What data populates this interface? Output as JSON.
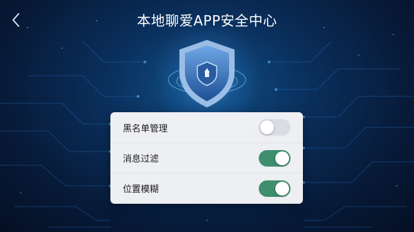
{
  "header": {
    "title": "本地聊爱APP安全中心",
    "back_icon": "chevron-left-icon"
  },
  "hero": {
    "icon": "shield-icon"
  },
  "settings": [
    {
      "label": "黑名单管理",
      "enabled": false
    },
    {
      "label": "消息过滤",
      "enabled": true
    },
    {
      "label": "位置模糊",
      "enabled": true
    }
  ],
  "colors": {
    "background": "#071a38",
    "toggle_on": "#3f8f6e",
    "toggle_off": "#dcdde2",
    "card": "#f6f6f8"
  }
}
